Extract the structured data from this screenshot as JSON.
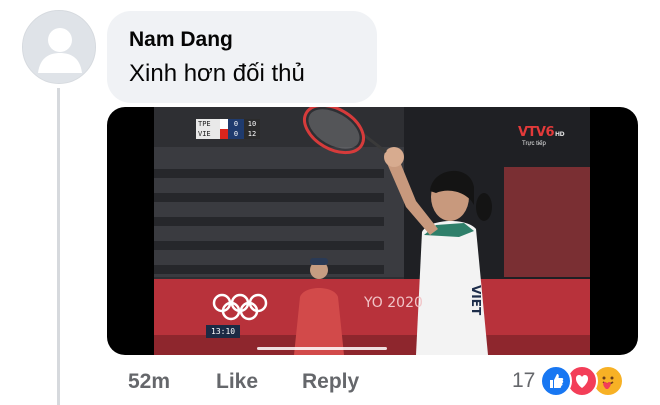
{
  "comment": {
    "author": "Nam Dang",
    "text": "Xinh hơn đối thủ",
    "time": "52m",
    "like_label": "Like",
    "reply_label": "Reply",
    "reaction_count": "17",
    "reactions": [
      "like",
      "love",
      "care"
    ]
  },
  "video": {
    "scoreboard": {
      "team1": "TPE",
      "team2": "VIE",
      "team1_sets": "0",
      "team1_points": "10",
      "team2_sets": "0",
      "team2_points": "12"
    },
    "channel": "VTV6",
    "channel_hd": "HD",
    "live_label": "Trực tiếp",
    "clock": "13:10",
    "venue_text": "YO 2020",
    "jersey_text": "VIET"
  },
  "colors": {
    "bubble": "#f0f2f5",
    "action_text": "#65676b",
    "like_blue": "#1877f2",
    "love_red": "#f33e58",
    "care_yellow": "#f7b125"
  }
}
